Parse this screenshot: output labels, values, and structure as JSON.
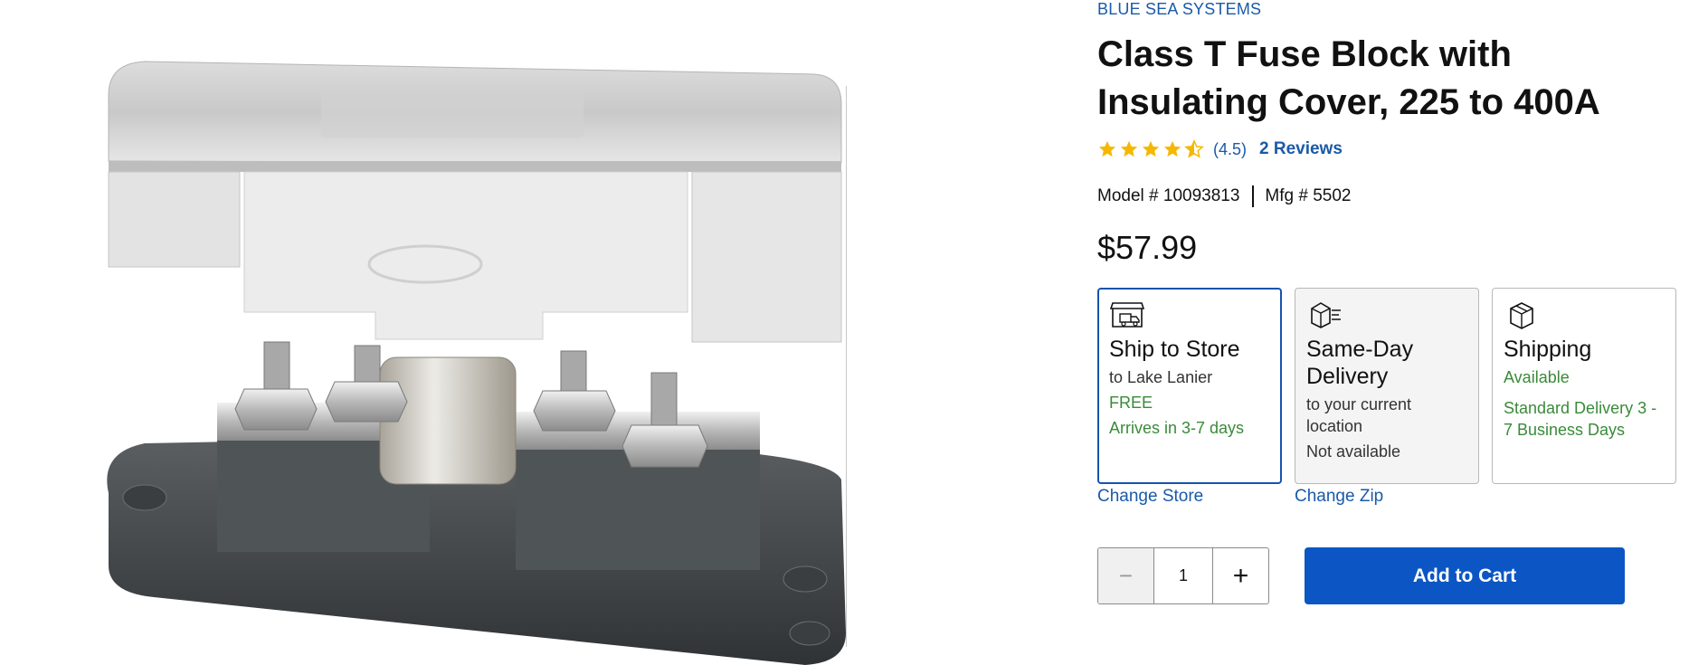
{
  "product": {
    "brand": "BLUE SEA SYSTEMS",
    "title": "Class T Fuse Block with Insulating Cover, 225 to 400A",
    "rating": 4.5,
    "rating_text": "(4.5)",
    "reviews_label": "2 Reviews",
    "model_label": "Model # 10093813",
    "mfg_label": "Mfg # 5502",
    "price": "$57.99",
    "image_alt": "fuse-block-product-image"
  },
  "fulfillment": [
    {
      "id": "ship-to-store",
      "icon": "store-truck-icon",
      "title": "Ship to Store",
      "lines": [
        {
          "text": "to Lake Lanier",
          "style": "normal"
        },
        {
          "text": "FREE",
          "style": "green"
        },
        {
          "text": "Arrives in 3-7 days",
          "style": "green"
        }
      ],
      "selected": true,
      "link": "Change Store"
    },
    {
      "id": "same-day-delivery",
      "icon": "fast-box-icon",
      "title": "Same-Day Delivery",
      "lines": [
        {
          "text": "to your current location",
          "style": "normal"
        },
        {
          "text": "Not available",
          "style": "normal"
        }
      ],
      "selected": false,
      "link": "Change Zip"
    },
    {
      "id": "shipping",
      "icon": "box-icon",
      "title": "Shipping",
      "lines": [
        {
          "text": "Available",
          "style": "green"
        },
        {
          "text": "Standard Delivery 3 - 7 Business Days",
          "style": "green"
        }
      ],
      "selected": false,
      "link": ""
    }
  ],
  "quantity": {
    "minus_label": "−",
    "value": "1",
    "plus_label": "+"
  },
  "cart": {
    "add_label": "Add to Cart"
  },
  "colors": {
    "link_blue": "#1a5aa8",
    "button_blue": "#0b56c4",
    "star_gold": "#f5b800",
    "available_green": "#3a8a3a"
  }
}
